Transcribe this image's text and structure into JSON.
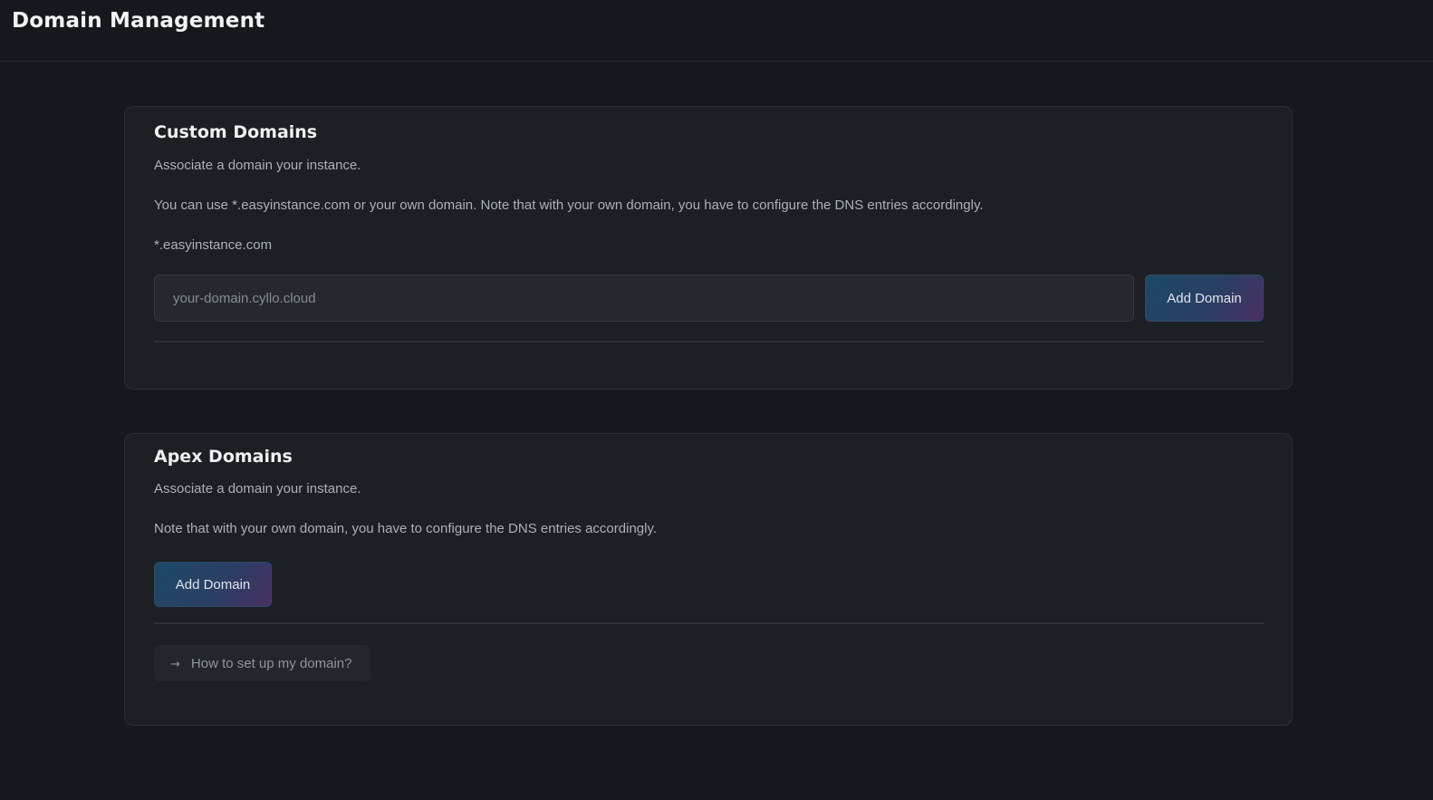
{
  "header": {
    "title": "Domain Management"
  },
  "custom_domains": {
    "title": "Custom Domains",
    "description": "Associate a domain your instance.",
    "note": "You can use *.easyinstance.com or your own domain. Note that with your own domain, you have to configure the DNS entries accordingly.",
    "suffix": "*.easyinstance.com",
    "input": {
      "value": "",
      "placeholder": "your-domain.cyllo.cloud"
    },
    "add_button_label": "Add Domain"
  },
  "apex_domains": {
    "title": "Apex Domains",
    "description": "Associate a domain your instance.",
    "note": "Note that with your own domain, you have to configure the DNS entries accordingly.",
    "add_button_label": "Add Domain",
    "help_link": {
      "icon": "arrow-right-icon",
      "glyph": "→",
      "label": "How to set up my domain?"
    }
  },
  "colors": {
    "background": "#15191d",
    "card": "#1c1f23",
    "button_gradient_start": "#1c4968",
    "button_gradient_end": "#4a2f63"
  }
}
